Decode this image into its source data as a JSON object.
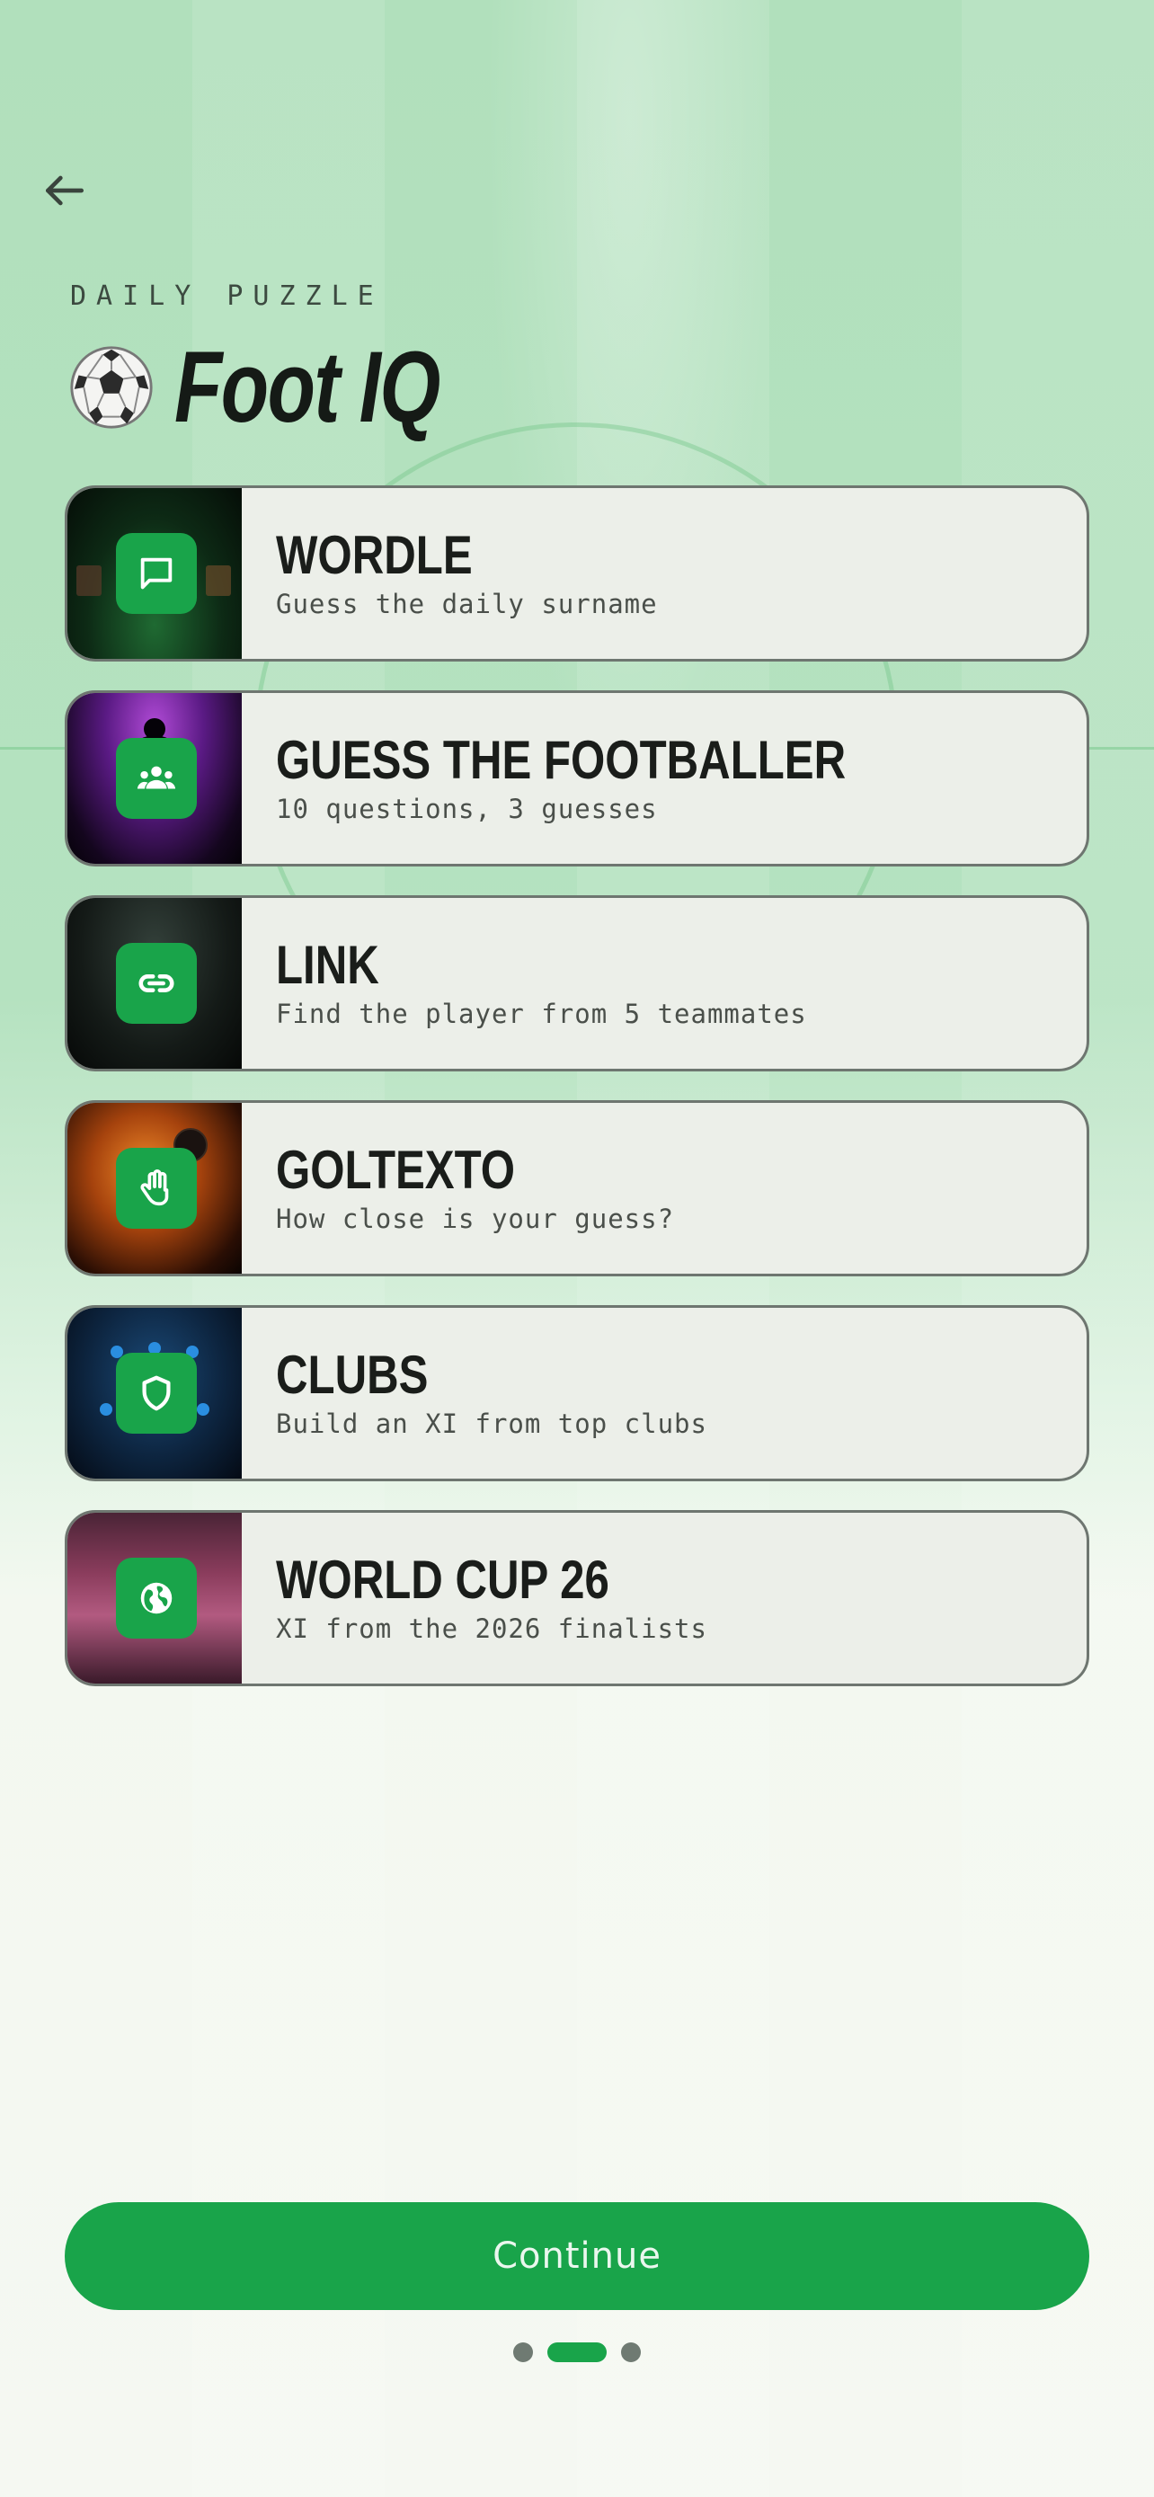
{
  "header": {
    "eyebrow": "DAILY PUZZLE",
    "title": "Foot IQ"
  },
  "games": [
    {
      "title": "WORDLE",
      "subtitle": "Guess the daily surname",
      "icon": "chat-bubble-icon"
    },
    {
      "title": "GUESS THE FOOTBALLER",
      "subtitle": "10 questions, 3 guesses",
      "icon": "group-icon"
    },
    {
      "title": "LINK",
      "subtitle": "Find the player from 5 teammates",
      "icon": "link-icon"
    },
    {
      "title": "GOLTEXTO",
      "subtitle": "How close is your guess?",
      "icon": "hand-icon"
    },
    {
      "title": "CLUBS",
      "subtitle": "Build an XI from top clubs",
      "icon": "shield-icon"
    },
    {
      "title": "WORLD CUP 26",
      "subtitle": "XI from the 2026 finalists",
      "icon": "globe-icon"
    }
  ],
  "footer": {
    "continue_label": "Continue",
    "page_count": 3,
    "active_page": 2
  },
  "colors": {
    "accent": "#19a44a",
    "background_top": "#b1e0bc",
    "background_bottom": "#f5f8f2",
    "card_bg": "#ecefe9"
  }
}
